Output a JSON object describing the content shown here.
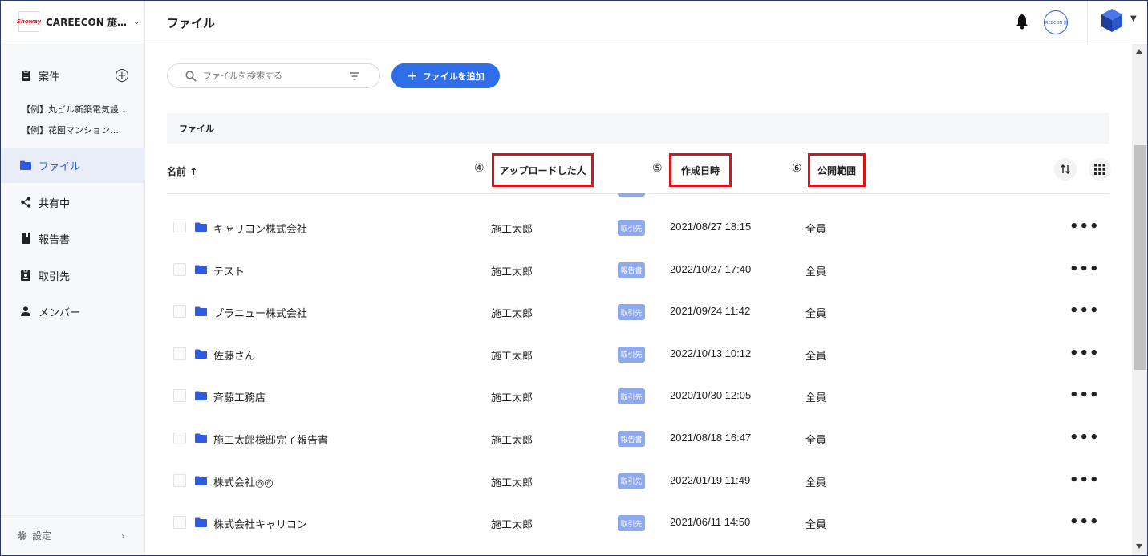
{
  "sidebar": {
    "brand_name": "CAREECON 施…",
    "brand_logo_text": "Showay",
    "project_label": "案件",
    "projects": [
      "【例】丸ビル新築電気設…",
      "【例】花園マンション…"
    ],
    "nav": [
      {
        "label": "ファイル",
        "icon": "folder-icon"
      },
      {
        "label": "共有中",
        "icon": "share-icon"
      },
      {
        "label": "報告書",
        "icon": "book-icon"
      },
      {
        "label": "取引先",
        "icon": "badge-icon"
      },
      {
        "label": "メンバー",
        "icon": "person-icon"
      }
    ],
    "settings_label": "設定"
  },
  "header": {
    "title": "ファイル",
    "avatar_text": "CAREECON 施工"
  },
  "toolbar": {
    "search_placeholder": "ファイルを検索する",
    "add_button_label": "ファイルを追加"
  },
  "section": {
    "title": "ファイル"
  },
  "columns": {
    "name": "名前 ↑",
    "uploader_marker": "④",
    "uploader": "アップロードした人",
    "created_marker": "⑤",
    "created": "作成日時",
    "visibility_marker": "⑥",
    "visibility": "公開範囲"
  },
  "files": [
    {
      "name": "キャリコン株式会社",
      "uploader": "施工太郎",
      "tag": "取引先",
      "date": "2021/08/27 18:15",
      "scope": "全員"
    },
    {
      "name": "テスト",
      "uploader": "施工太郎",
      "tag": "報告書",
      "date": "2022/10/27 17:40",
      "scope": "全員"
    },
    {
      "name": "プラニュー株式会社",
      "uploader": "施工太郎",
      "tag": "取引先",
      "date": "2021/09/24 11:42",
      "scope": "全員"
    },
    {
      "name": "佐藤さん",
      "uploader": "施工太郎",
      "tag": "取引先",
      "date": "2022/10/13 10:12",
      "scope": "全員"
    },
    {
      "name": "斉藤工務店",
      "uploader": "施工太郎",
      "tag": "取引先",
      "date": "2020/10/30 12:05",
      "scope": "全員"
    },
    {
      "name": "施工太郎様邸完了報告書",
      "uploader": "施工太郎",
      "tag": "報告書",
      "date": "2021/08/18 16:47",
      "scope": "全員"
    },
    {
      "name": "株式会社◎◎",
      "uploader": "施工太郎",
      "tag": "取引先",
      "date": "2022/01/19 11:49",
      "scope": "全員"
    },
    {
      "name": "株式会社キャリコン",
      "uploader": "施工太郎",
      "tag": "取引先",
      "date": "2021/06/11 14:50",
      "scope": "全員"
    }
  ],
  "colors": {
    "accent": "#2f6ee8",
    "badge": "#8fa9ee",
    "highlight_box": "#d9141b",
    "active_nav_bg": "#e9edf8"
  }
}
